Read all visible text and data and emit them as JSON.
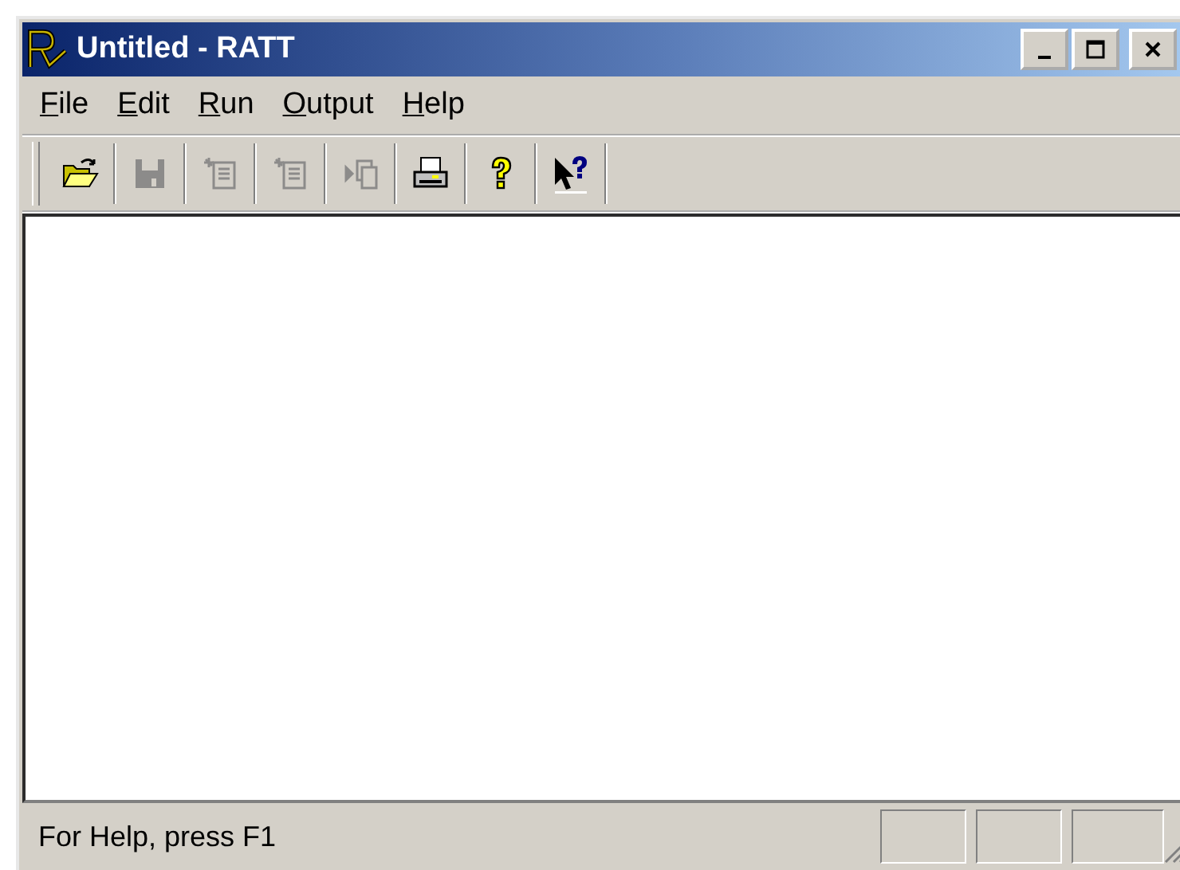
{
  "window": {
    "title": "Untitled - RATT"
  },
  "menu": [
    {
      "label": "File"
    },
    {
      "label": "Edit"
    },
    {
      "label": "Run"
    },
    {
      "label": "Output"
    },
    {
      "label": "Help"
    }
  ],
  "toolbar": [
    {
      "kind": "open",
      "disabled": false
    },
    {
      "kind": "save",
      "disabled": true
    },
    {
      "kind": "doc",
      "disabled": true
    },
    {
      "kind": "doc2",
      "disabled": true
    },
    {
      "kind": "run",
      "disabled": true
    },
    {
      "kind": "print",
      "disabled": false
    },
    {
      "kind": "help",
      "disabled": false
    },
    {
      "kind": "context-help",
      "disabled": false
    }
  ],
  "status_bar": {
    "text": "For Help, press F1"
  }
}
